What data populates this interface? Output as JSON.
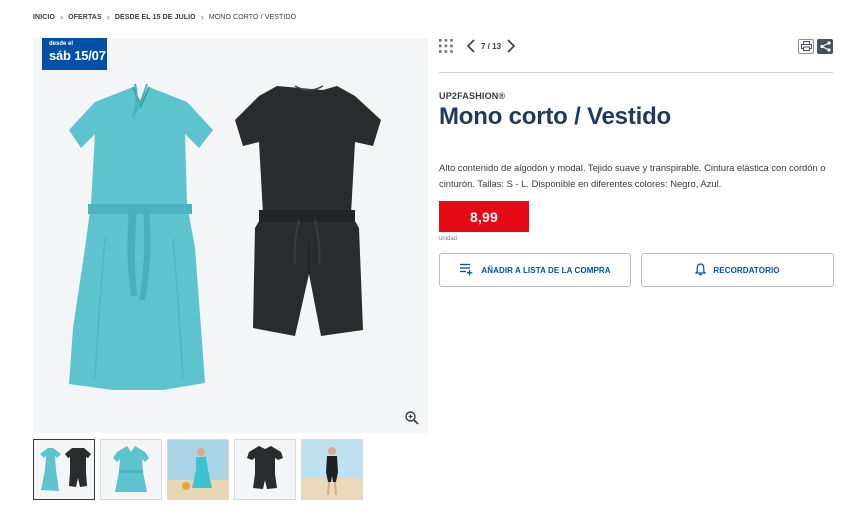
{
  "breadcrumb": [
    {
      "label": "INICIO"
    },
    {
      "label": "OFERTAS"
    },
    {
      "label": "DESDE EL 15 DE JULIO"
    },
    {
      "label": "MONO CORTO / VESTIDO"
    }
  ],
  "badge": {
    "line1": "desde el",
    "line2": "sáb 15/07"
  },
  "gallery": {
    "zoom_icon": "zoom-in-icon"
  },
  "thumbnails": [
    {
      "name": "both-garments"
    },
    {
      "name": "blue-dress"
    },
    {
      "name": "model-blue-dress"
    },
    {
      "name": "black-jumpsuit"
    },
    {
      "name": "model-black-jumpsuit"
    }
  ],
  "toolbar": {
    "pager": "7 / 13"
  },
  "product": {
    "brand": "UP2FASHION®",
    "title": "Mono corto / Vestido",
    "description": "Alto contenido de algodón y modal. Tejido suave y transpirable. Cintura elástica con cordón o cinturón. Tallas: S - L. Disponible en diferentes colores: Negro, Azul.",
    "price": "8,99",
    "unit": "unidad"
  },
  "buttons": {
    "add_to_list": "AÑADIR A LISTA DE LA COMPRA",
    "reminder": "RECORDATORIO"
  },
  "colors": {
    "brand_blue": "#0050aa",
    "price_red": "#e60a14",
    "title_navy": "#1f3a5c",
    "dress_blue": "#5cc3cf",
    "jumpsuit_black": "#2a2b2d"
  }
}
